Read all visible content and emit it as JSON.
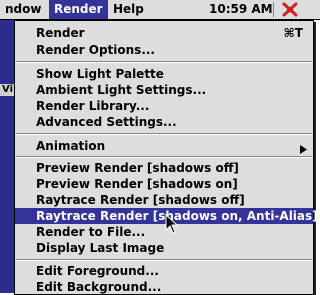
{
  "menubar": {
    "items": [
      {
        "label": "ndow"
      },
      {
        "label": "Render"
      },
      {
        "label": "Help"
      }
    ],
    "clock": "10:59 AM",
    "app_icon": "app-switcher-icon"
  },
  "background_window": {
    "fragment_label": "Vi"
  },
  "render_menu": {
    "items": [
      {
        "label": "Render",
        "shortcut": "⌘T"
      },
      {
        "label": "Render Options..."
      },
      {
        "label": "Show Light Palette"
      },
      {
        "label": "Ambient Light Settings..."
      },
      {
        "label": "Render Library..."
      },
      {
        "label": "Advanced Settings..."
      },
      {
        "label": "Animation",
        "submenu_icon": "triangle-right-icon"
      },
      {
        "label": "Preview Render [shadows off]"
      },
      {
        "label": "Preview Render [shadows on]"
      },
      {
        "label": "Raytrace Render [shadows off]"
      },
      {
        "label": "Raytrace Render [shadows on, Anti-Alias]",
        "highlighted": true
      },
      {
        "label": "Render to File..."
      },
      {
        "label": "Display Last Image"
      },
      {
        "label": "Edit Foreground..."
      },
      {
        "label": "Edit Background..."
      }
    ]
  },
  "colors": {
    "menu_bg": "#dddddd",
    "highlight": "#33339a",
    "highlight_text": "#ffffff",
    "desktop_bg": "#2c2c8c",
    "app_icon_red": "#cc2222"
  },
  "cursor_icon": "arrow-pointer-icon"
}
